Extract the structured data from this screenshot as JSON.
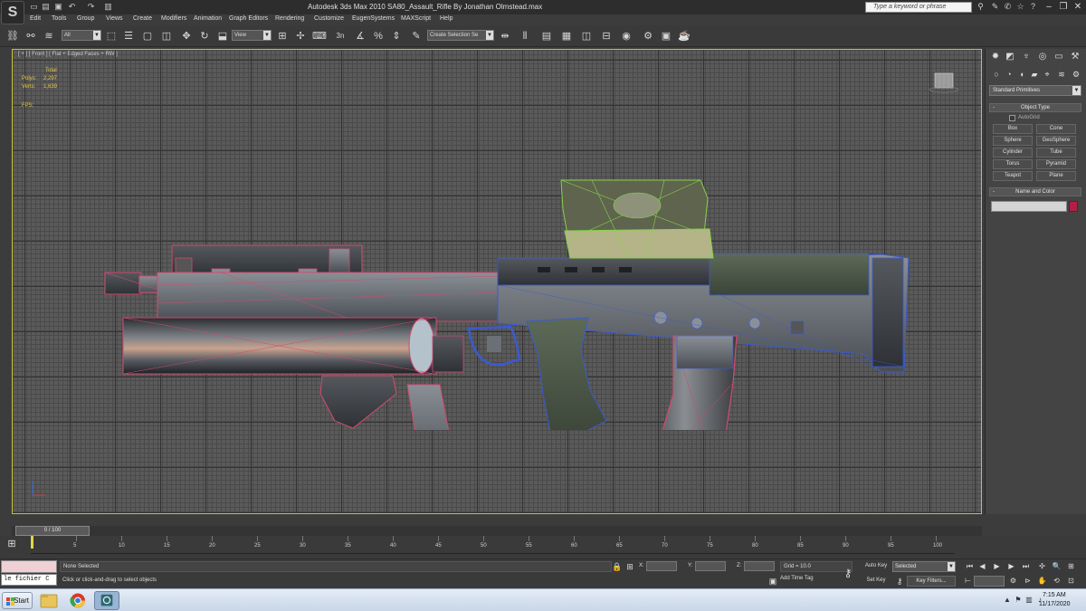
{
  "app": {
    "title": "Autodesk 3ds Max 2010       SA80_Assault_Rifle By Jonathan Olmstead.max",
    "logo": "S"
  },
  "search": {
    "placeholder": "Type a keyword or phrase"
  },
  "menu": [
    "Edit",
    "Tools",
    "Group",
    "Views",
    "Create",
    "Modifiers",
    "Animation",
    "Graph Editors",
    "Rendering",
    "Customize",
    "EugenSystems",
    "MAXScript",
    "Help"
  ],
  "toolbar": {
    "selection_filter": "All",
    "reference_coord": "View",
    "named_selection": "Create Selection Se",
    "snaps_label": "3n"
  },
  "viewport": {
    "label": "[ + ] [ Front ] [ Flat + Edged Faces + RW ]",
    "stats": {
      "total": "Total",
      "polys_label": "Polys:",
      "polys": "2,297",
      "verts_label": "Verts:",
      "verts": "1,639",
      "fps_label": "FPS:"
    }
  },
  "command_panel": {
    "category": "Standard Primitives",
    "object_type_title": "Object Type",
    "autogrid": "AutoGrid",
    "primitives": [
      "Box",
      "Cone",
      "Sphere",
      "GeoSphere",
      "Cylinder",
      "Tube",
      "Torus",
      "Pyramid",
      "Teapot",
      "Plane"
    ],
    "name_color_title": "Name and Color",
    "object_color": "#b41e46"
  },
  "timeline": {
    "time_slider": "0 / 100",
    "ticks": [
      "5",
      "10",
      "15",
      "20",
      "25",
      "30",
      "35",
      "40",
      "45",
      "50",
      "55",
      "60",
      "65",
      "70",
      "75",
      "80",
      "85",
      "90",
      "95",
      "100"
    ]
  },
  "status": {
    "maxscript_output": "le fichier C",
    "selection": "None Selected",
    "prompt": "Click or click-and-drag to select objects",
    "x_label": "X:",
    "y_label": "Y:",
    "z_label": "Z:",
    "grid": "Grid = 10.0",
    "add_time_tag": "Add Time Tag",
    "auto_key": "Auto Key",
    "set_key": "Set Key",
    "key_mode": "Selected",
    "key_filters": "Key Filters..."
  },
  "taskbar": {
    "start": "Start",
    "time": "7:15 AM",
    "date": "11/17/2020"
  },
  "colors": {
    "viewport_bg": "#5a5a5a",
    "active_border": "#c8c13a",
    "stats_text": "#e6c84a",
    "selection_pink": "#d24a6e",
    "scope_green": "#8ad24a",
    "receiver_blue": "#3a5ad2"
  }
}
